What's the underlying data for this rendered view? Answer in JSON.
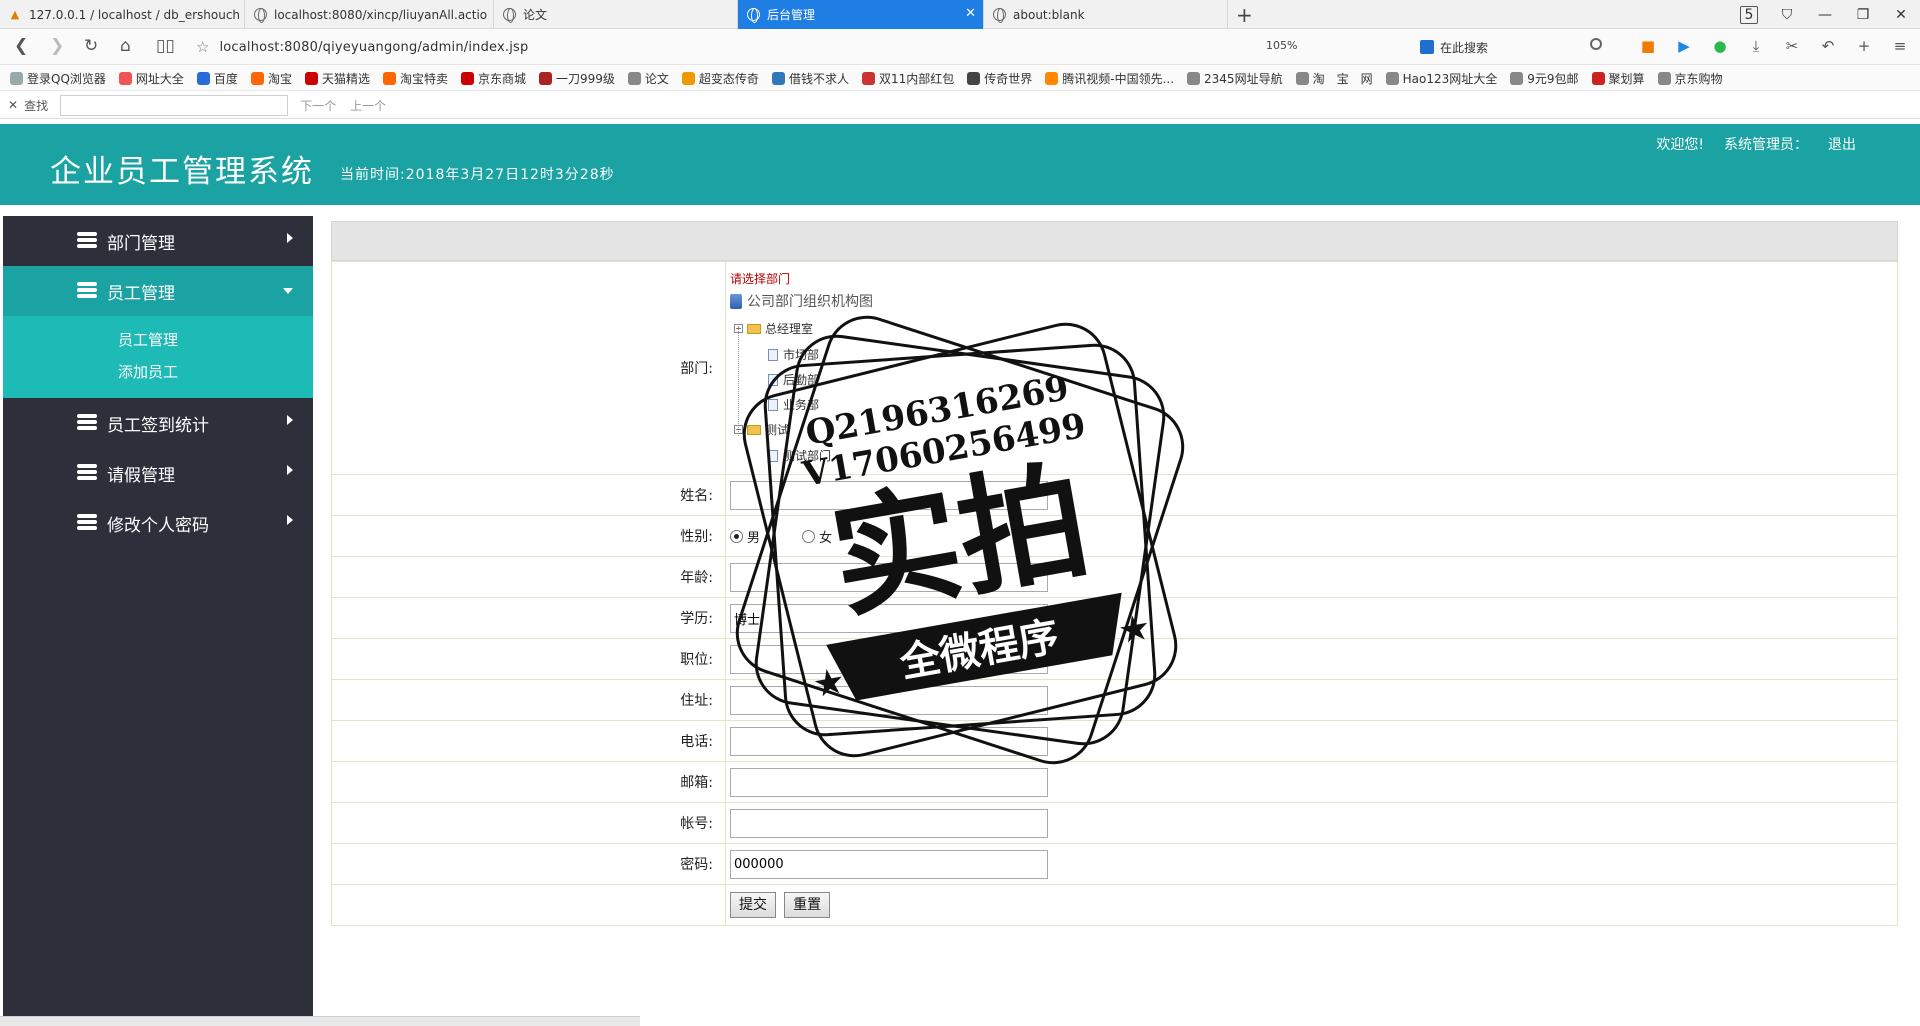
{
  "browser": {
    "tabs": [
      {
        "label": "127.0.0.1 / localhost / db_ershouch",
        "active": false
      },
      {
        "label": "localhost:8080/xincp/liuyanAll.actio",
        "active": false
      },
      {
        "label": "论文",
        "active": false
      },
      {
        "label": "后台管理",
        "active": true
      },
      {
        "label": "about:blank",
        "active": false
      }
    ],
    "tab_count": "5",
    "url": "localhost:8080/qiyeyuangong/admin/index.jsp",
    "zoom": "105%",
    "search_placeholder": "在此搜索",
    "bookmarks": [
      "登录QQ浏览器",
      "网址大全",
      "百度",
      "淘宝",
      "天猫精选",
      "淘宝特卖",
      "京东商城",
      "一刀999级",
      "论文",
      "超变态传奇",
      "借钱不求人",
      "双11内部红包",
      "传奇世界",
      "腾讯视频-中国领先...",
      "2345网址导航",
      "淘　宝　网",
      "Hao123网址大全",
      "9元9包邮",
      "聚划算",
      "京东购物"
    ],
    "find": {
      "label": "查找",
      "next": "下一个",
      "prev": "上一个"
    }
  },
  "header": {
    "title": "企业员工管理系统",
    "time": "当前时间:2018年3月27日12时3分28秒",
    "welcome": "欢迎您!",
    "role": "系统管理员：",
    "logout": "退出"
  },
  "sidebar": {
    "items": [
      {
        "label": "部门管理"
      },
      {
        "label": "员工管理",
        "open": true,
        "children": [
          "员工管理",
          "添加员工"
        ]
      },
      {
        "label": "员工签到统计"
      },
      {
        "label": "请假管理"
      },
      {
        "label": "修改个人密码"
      }
    ]
  },
  "form": {
    "dept": {
      "label": "部门:",
      "hint": "请选择部门",
      "root": "公司部门组织机构图",
      "groups": [
        {
          "name": "总经理室",
          "children": [
            "市场部",
            "后勤部",
            "业务部"
          ]
        },
        {
          "name": "测试",
          "children": [
            "测试部门"
          ]
        }
      ]
    },
    "name": {
      "label": "姓名:",
      "value": ""
    },
    "gender": {
      "label": "性别:",
      "options": [
        "男",
        "女"
      ],
      "selected": "男"
    },
    "age": {
      "label": "年龄:",
      "value": ""
    },
    "education": {
      "label": "学历:",
      "value": "博士"
    },
    "position": {
      "label": "职位:",
      "value": ""
    },
    "address": {
      "label": "住址:",
      "value": ""
    },
    "phone": {
      "label": "电话:",
      "value": ""
    },
    "email": {
      "label": "邮箱:",
      "value": ""
    },
    "account": {
      "label": "帐号:",
      "value": ""
    },
    "password": {
      "label": "密码:",
      "value": "000000"
    },
    "submit": "提交",
    "reset": "重置"
  },
  "watermark": {
    "line1": "Q2196316269",
    "line2": "V17060256499",
    "big": "实拍",
    "banner": "全微程序"
  }
}
